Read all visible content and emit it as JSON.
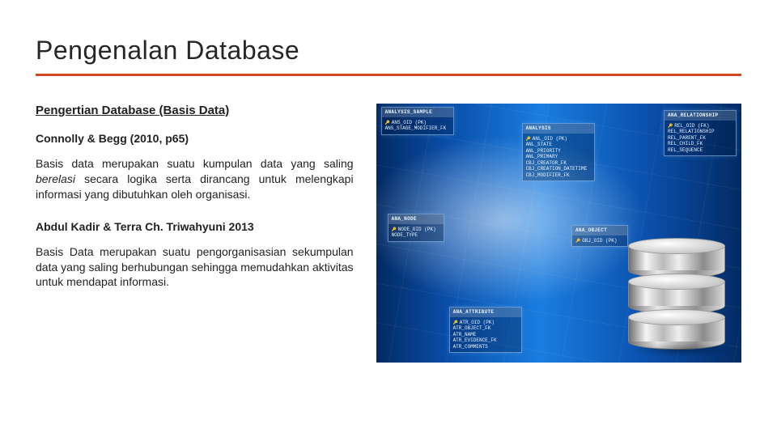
{
  "title": "Pengenalan Database",
  "section_heading": "Pengertian Database (Basis Data)",
  "def1": {
    "citation": "Connolly & Begg (2010, p65)",
    "lead": "Basis data merupakan suatu kumpulan data yang saling ",
    "emph": "berelasi",
    "tail": " secara logika serta dirancang untuk melengkapi informasi yang dibutuhkan oleh organisasi."
  },
  "def2": {
    "citation": "Abdul Kadir & Terra Ch. Triwahyuni 2013",
    "text": "Basis Data merupakan suatu pengorganisasian sekumpulan data yang saling berhubungan sehingga memudahkan aktivitas untuk mendapat informasi."
  },
  "image": {
    "alt": "Database schema diagram with stacked database cylinders",
    "er_tables": {
      "analysis": {
        "title": "ANALYSIS",
        "rows": [
          "ANL_OID (PK)",
          "ANL_STATE",
          "ANL_PRIORITY",
          "ANL_PRIMARY",
          "CBJ_CREATOR_FK",
          "CBJ_CREATION_DATETIME",
          "CBJ_MODIFIER_FK"
        ]
      },
      "sample": {
        "title": "ANALYSIS_SAMPLE",
        "rows": [
          "ANS_OID (PK)",
          "ANS_STAGE_MODIFIER_FK"
        ]
      },
      "rel": {
        "title": "ANA_RELATIONSHIP",
        "rows": [
          "REL_OID (FK)",
          "REL_RELATIONSHIP",
          "REL_PARENT_FK",
          "REL_CHILD_FK",
          "REL_SEQUENCE"
        ]
      },
      "attr": {
        "title": "ANA_ATTRIBUTE",
        "rows": [
          "ATR_OID (PK)",
          "ATR_OBJECT_FK",
          "ATR_NAME",
          "ATR_EVIDENCE_FK",
          "ATR_COMMENTS"
        ]
      },
      "node": {
        "title": "ANA_NODE",
        "rows": [
          "NODE_OID (PK)",
          "NODE_TYPE"
        ]
      },
      "obj": {
        "title": "ANA_OBJECT",
        "rows": [
          "OBJ_OID (PK)"
        ]
      }
    }
  }
}
